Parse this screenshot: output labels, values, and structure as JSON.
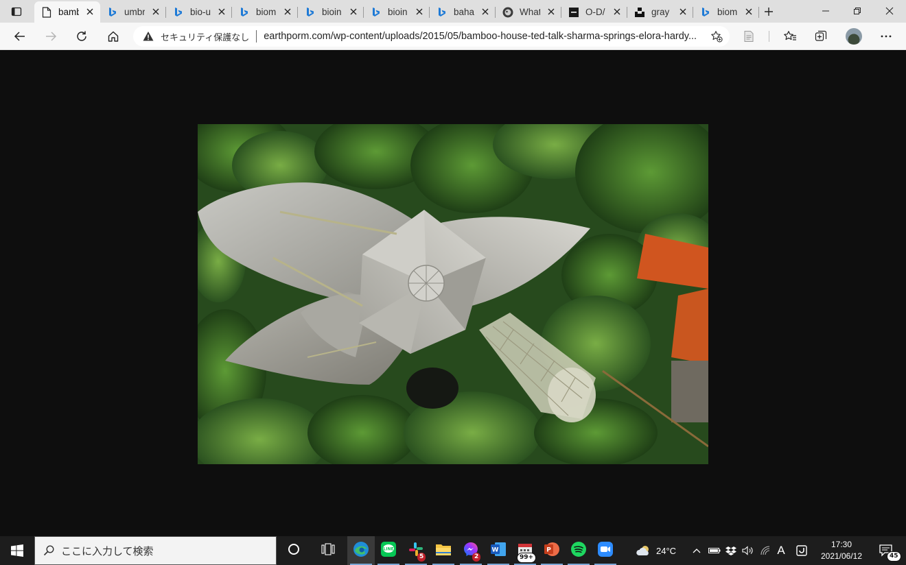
{
  "browser": {
    "tabs": [
      {
        "title": "bamboo",
        "icon": "page-icon",
        "active": true
      },
      {
        "title": "umbrella",
        "icon": "bing-icon"
      },
      {
        "title": "bio-u",
        "icon": "bing-icon"
      },
      {
        "title": "biom",
        "icon": "bing-icon"
      },
      {
        "title": "bioin",
        "icon": "bing-icon"
      },
      {
        "title": "bioin",
        "icon": "bing-icon"
      },
      {
        "title": "baha",
        "icon": "bing-icon"
      },
      {
        "title": "What",
        "icon": "github-icon"
      },
      {
        "title": "O-D/",
        "icon": "dark-square-icon"
      },
      {
        "title": "gray",
        "icon": "unsplash-icon"
      },
      {
        "title": "biom",
        "icon": "bing-icon"
      }
    ],
    "address": {
      "security_label": "セキュリティ保護なし",
      "url": "earthporm.com/wp-content/uploads/2015/05/bamboo-house-ted-talk-sharma-springs-elora-hardy..."
    }
  },
  "taskbar": {
    "search_placeholder": "ここに入力して検索",
    "pinned": [
      {
        "name": "cortana-icon"
      },
      {
        "name": "task-view-icon"
      },
      {
        "name": "edge-icon",
        "active": true
      },
      {
        "name": "line-icon"
      },
      {
        "name": "slack-icon",
        "badge": "5"
      },
      {
        "name": "file-explorer-icon"
      },
      {
        "name": "messenger-icon",
        "badge": "2"
      },
      {
        "name": "word-icon"
      },
      {
        "name": "calendar-icon",
        "badge": "99+"
      },
      {
        "name": "powerpoint-icon"
      },
      {
        "name": "spotify-icon"
      },
      {
        "name": "zoom-icon"
      }
    ],
    "weather": {
      "temperature": "24°C"
    },
    "ime": "A",
    "clock": {
      "time": "17:30",
      "date": "2021/06/12"
    },
    "notifications": "45"
  },
  "colors": {
    "tabstrip": "#dfdfdf",
    "toolbar": "#f7f7f7",
    "page_background": "#0e0e0e",
    "taskbar": "#1d1d1d",
    "bing_blue": "#1e7ad6"
  }
}
